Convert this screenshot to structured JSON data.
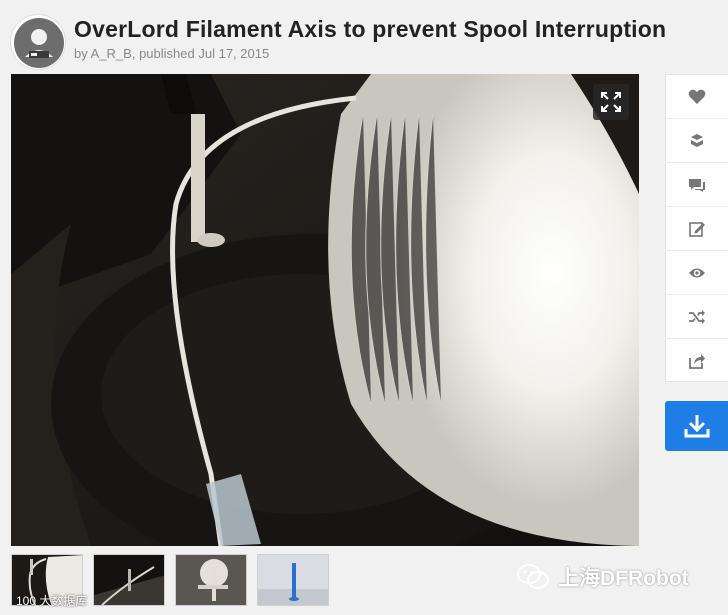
{
  "header": {
    "title": "OverLord Filament Axis to prevent Spool Interruption",
    "byline_prefix": "by",
    "author": "A_R_B",
    "published_label": "published",
    "published_date": "Jul 17, 2015"
  },
  "viewer": {
    "expand_icon": "expand-icon"
  },
  "actions": [
    {
      "name": "like",
      "icon": "heart-icon"
    },
    {
      "name": "collect",
      "icon": "layers-icon"
    },
    {
      "name": "comment",
      "icon": "comment-icon"
    },
    {
      "name": "remix",
      "icon": "edit-icon"
    },
    {
      "name": "watch",
      "icon": "eye-icon"
    },
    {
      "name": "shuffle",
      "icon": "shuffle-icon"
    },
    {
      "name": "share",
      "icon": "share-icon"
    }
  ],
  "download": {
    "icon": "download-icon"
  },
  "thumbnails": [
    {
      "name": "thumbnail-1"
    },
    {
      "name": "thumbnail-2"
    },
    {
      "name": "thumbnail-3"
    },
    {
      "name": "thumbnail-4"
    }
  ],
  "watermark": {
    "main": "上海DFRobot",
    "small": "100 大数据库"
  },
  "colors": {
    "accent": "#1f7de6",
    "background": "#f1f1f1",
    "title": "#222222",
    "meta": "#888888"
  }
}
